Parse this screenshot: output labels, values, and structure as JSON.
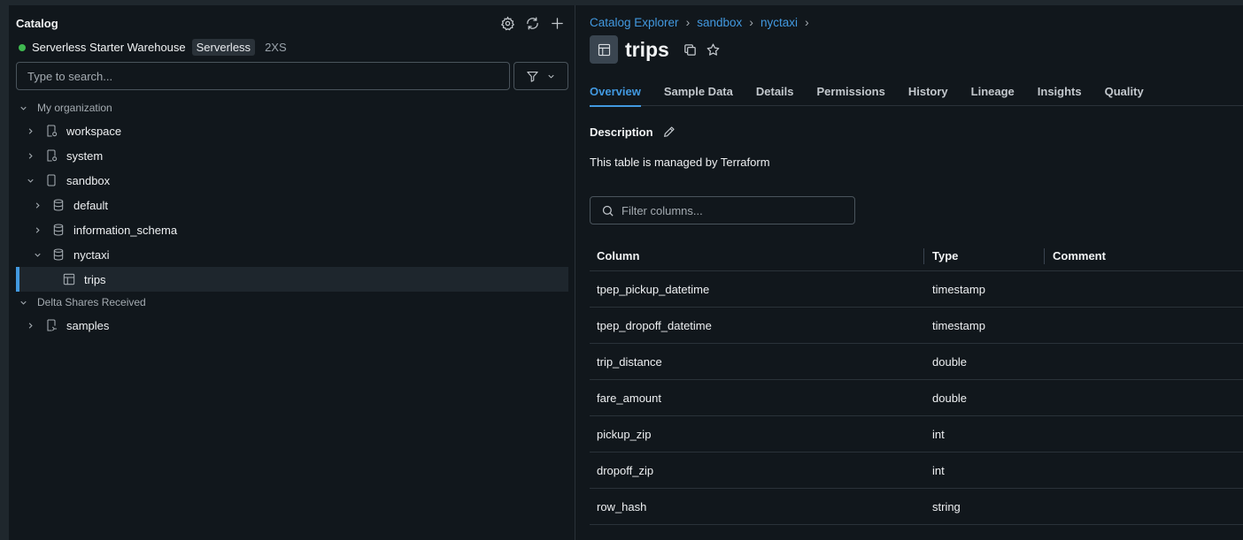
{
  "sidebar": {
    "title": "Catalog",
    "icons": [
      "gear-icon",
      "refresh-icon",
      "plus-icon"
    ],
    "warehouse": {
      "name": "Serverless Starter Warehouse",
      "badge": "Serverless",
      "size": "2XS",
      "status_color": "#3fb950"
    },
    "search": {
      "placeholder": "Type to search..."
    },
    "tree": [
      {
        "label": "My organization",
        "type": "section",
        "expanded": true
      },
      {
        "label": "workspace",
        "type": "catalog",
        "expanded": false
      },
      {
        "label": "system",
        "type": "catalog",
        "expanded": false
      },
      {
        "label": "sandbox",
        "type": "catalog",
        "expanded": true
      },
      {
        "label": "default",
        "type": "schema",
        "expanded": false
      },
      {
        "label": "information_schema",
        "type": "schema",
        "expanded": false
      },
      {
        "label": "nyctaxi",
        "type": "schema",
        "expanded": true
      },
      {
        "label": "trips",
        "type": "table",
        "selected": true
      },
      {
        "label": "Delta Shares Received",
        "type": "section",
        "expanded": true
      },
      {
        "label": "samples",
        "type": "catalog",
        "expanded": false
      }
    ]
  },
  "main": {
    "breadcrumbs": [
      "Catalog Explorer",
      "sandbox",
      "nyctaxi"
    ],
    "title": "trips",
    "tabs": [
      "Overview",
      "Sample Data",
      "Details",
      "Permissions",
      "History",
      "Lineage",
      "Insights",
      "Quality"
    ],
    "active_tab": "Overview",
    "description_label": "Description",
    "description": "This table is managed by Terraform",
    "filter_placeholder": "Filter columns...",
    "columns_header": [
      "Column",
      "Type",
      "Comment"
    ],
    "columns": [
      {
        "name": "tpep_pickup_datetime",
        "type": "timestamp",
        "comment": ""
      },
      {
        "name": "tpep_dropoff_datetime",
        "type": "timestamp",
        "comment": ""
      },
      {
        "name": "trip_distance",
        "type": "double",
        "comment": ""
      },
      {
        "name": "fare_amount",
        "type": "double",
        "comment": ""
      },
      {
        "name": "pickup_zip",
        "type": "int",
        "comment": ""
      },
      {
        "name": "dropoff_zip",
        "type": "int",
        "comment": ""
      },
      {
        "name": "row_hash",
        "type": "string",
        "comment": ""
      }
    ]
  },
  "colors": {
    "accent": "#4299e0",
    "background": "#11171c"
  }
}
